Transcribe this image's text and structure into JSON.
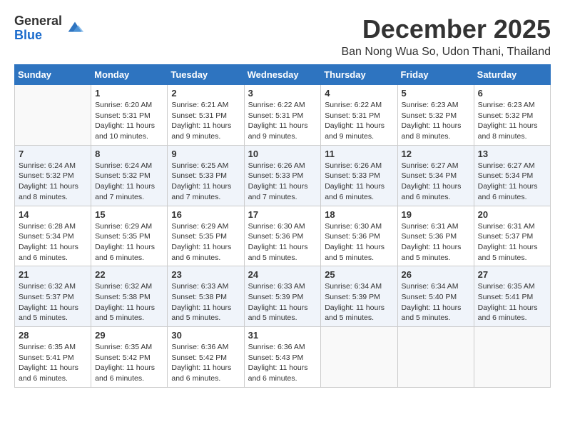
{
  "logo": {
    "general": "General",
    "blue": "Blue"
  },
  "title": "December 2025",
  "location": "Ban Nong Wua So, Udon Thani, Thailand",
  "days_of_week": [
    "Sunday",
    "Monday",
    "Tuesday",
    "Wednesday",
    "Thursday",
    "Friday",
    "Saturday"
  ],
  "weeks": [
    [
      {
        "day": "",
        "empty": true
      },
      {
        "day": "1",
        "sunrise": "Sunrise: 6:20 AM",
        "sunset": "Sunset: 5:31 PM",
        "daylight": "Daylight: 11 hours and 10 minutes."
      },
      {
        "day": "2",
        "sunrise": "Sunrise: 6:21 AM",
        "sunset": "Sunset: 5:31 PM",
        "daylight": "Daylight: 11 hours and 9 minutes."
      },
      {
        "day": "3",
        "sunrise": "Sunrise: 6:22 AM",
        "sunset": "Sunset: 5:31 PM",
        "daylight": "Daylight: 11 hours and 9 minutes."
      },
      {
        "day": "4",
        "sunrise": "Sunrise: 6:22 AM",
        "sunset": "Sunset: 5:31 PM",
        "daylight": "Daylight: 11 hours and 9 minutes."
      },
      {
        "day": "5",
        "sunrise": "Sunrise: 6:23 AM",
        "sunset": "Sunset: 5:32 PM",
        "daylight": "Daylight: 11 hours and 8 minutes."
      },
      {
        "day": "6",
        "sunrise": "Sunrise: 6:23 AM",
        "sunset": "Sunset: 5:32 PM",
        "daylight": "Daylight: 11 hours and 8 minutes."
      }
    ],
    [
      {
        "day": "7",
        "sunrise": "Sunrise: 6:24 AM",
        "sunset": "Sunset: 5:32 PM",
        "daylight": "Daylight: 11 hours and 8 minutes."
      },
      {
        "day": "8",
        "sunrise": "Sunrise: 6:24 AM",
        "sunset": "Sunset: 5:32 PM",
        "daylight": "Daylight: 11 hours and 7 minutes."
      },
      {
        "day": "9",
        "sunrise": "Sunrise: 6:25 AM",
        "sunset": "Sunset: 5:33 PM",
        "daylight": "Daylight: 11 hours and 7 minutes."
      },
      {
        "day": "10",
        "sunrise": "Sunrise: 6:26 AM",
        "sunset": "Sunset: 5:33 PM",
        "daylight": "Daylight: 11 hours and 7 minutes."
      },
      {
        "day": "11",
        "sunrise": "Sunrise: 6:26 AM",
        "sunset": "Sunset: 5:33 PM",
        "daylight": "Daylight: 11 hours and 6 minutes."
      },
      {
        "day": "12",
        "sunrise": "Sunrise: 6:27 AM",
        "sunset": "Sunset: 5:34 PM",
        "daylight": "Daylight: 11 hours and 6 minutes."
      },
      {
        "day": "13",
        "sunrise": "Sunrise: 6:27 AM",
        "sunset": "Sunset: 5:34 PM",
        "daylight": "Daylight: 11 hours and 6 minutes."
      }
    ],
    [
      {
        "day": "14",
        "sunrise": "Sunrise: 6:28 AM",
        "sunset": "Sunset: 5:34 PM",
        "daylight": "Daylight: 11 hours and 6 minutes."
      },
      {
        "day": "15",
        "sunrise": "Sunrise: 6:29 AM",
        "sunset": "Sunset: 5:35 PM",
        "daylight": "Daylight: 11 hours and 6 minutes."
      },
      {
        "day": "16",
        "sunrise": "Sunrise: 6:29 AM",
        "sunset": "Sunset: 5:35 PM",
        "daylight": "Daylight: 11 hours and 6 minutes."
      },
      {
        "day": "17",
        "sunrise": "Sunrise: 6:30 AM",
        "sunset": "Sunset: 5:36 PM",
        "daylight": "Daylight: 11 hours and 5 minutes."
      },
      {
        "day": "18",
        "sunrise": "Sunrise: 6:30 AM",
        "sunset": "Sunset: 5:36 PM",
        "daylight": "Daylight: 11 hours and 5 minutes."
      },
      {
        "day": "19",
        "sunrise": "Sunrise: 6:31 AM",
        "sunset": "Sunset: 5:36 PM",
        "daylight": "Daylight: 11 hours and 5 minutes."
      },
      {
        "day": "20",
        "sunrise": "Sunrise: 6:31 AM",
        "sunset": "Sunset: 5:37 PM",
        "daylight": "Daylight: 11 hours and 5 minutes."
      }
    ],
    [
      {
        "day": "21",
        "sunrise": "Sunrise: 6:32 AM",
        "sunset": "Sunset: 5:37 PM",
        "daylight": "Daylight: 11 hours and 5 minutes."
      },
      {
        "day": "22",
        "sunrise": "Sunrise: 6:32 AM",
        "sunset": "Sunset: 5:38 PM",
        "daylight": "Daylight: 11 hours and 5 minutes."
      },
      {
        "day": "23",
        "sunrise": "Sunrise: 6:33 AM",
        "sunset": "Sunset: 5:38 PM",
        "daylight": "Daylight: 11 hours and 5 minutes."
      },
      {
        "day": "24",
        "sunrise": "Sunrise: 6:33 AM",
        "sunset": "Sunset: 5:39 PM",
        "daylight": "Daylight: 11 hours and 5 minutes."
      },
      {
        "day": "25",
        "sunrise": "Sunrise: 6:34 AM",
        "sunset": "Sunset: 5:39 PM",
        "daylight": "Daylight: 11 hours and 5 minutes."
      },
      {
        "day": "26",
        "sunrise": "Sunrise: 6:34 AM",
        "sunset": "Sunset: 5:40 PM",
        "daylight": "Daylight: 11 hours and 5 minutes."
      },
      {
        "day": "27",
        "sunrise": "Sunrise: 6:35 AM",
        "sunset": "Sunset: 5:41 PM",
        "daylight": "Daylight: 11 hours and 6 minutes."
      }
    ],
    [
      {
        "day": "28",
        "sunrise": "Sunrise: 6:35 AM",
        "sunset": "Sunset: 5:41 PM",
        "daylight": "Daylight: 11 hours and 6 minutes."
      },
      {
        "day": "29",
        "sunrise": "Sunrise: 6:35 AM",
        "sunset": "Sunset: 5:42 PM",
        "daylight": "Daylight: 11 hours and 6 minutes."
      },
      {
        "day": "30",
        "sunrise": "Sunrise: 6:36 AM",
        "sunset": "Sunset: 5:42 PM",
        "daylight": "Daylight: 11 hours and 6 minutes."
      },
      {
        "day": "31",
        "sunrise": "Sunrise: 6:36 AM",
        "sunset": "Sunset: 5:43 PM",
        "daylight": "Daylight: 11 hours and 6 minutes."
      },
      {
        "day": "",
        "empty": true
      },
      {
        "day": "",
        "empty": true
      },
      {
        "day": "",
        "empty": true
      }
    ]
  ]
}
